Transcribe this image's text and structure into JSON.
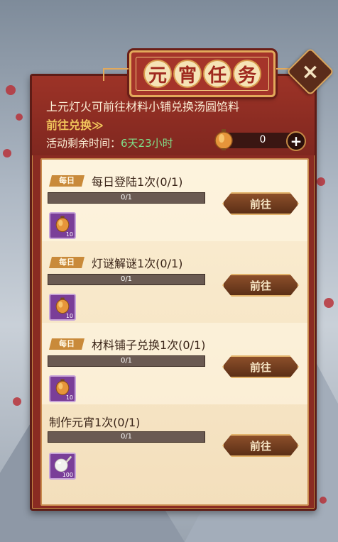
{
  "title": [
    "元",
    "宵",
    "任",
    "务"
  ],
  "description": "上元灯火可前往材料小铺兑换汤圆馅料",
  "goto_link": "前往兑换≫",
  "time_label": "活动剩余时间：",
  "time_value": "6天23小时",
  "currency": {
    "icon": "lantern-icon",
    "value": "0",
    "add_icon": "plus-icon"
  },
  "tasks": [
    {
      "tag": "每日",
      "title": "每日登陆1次(0/1)",
      "progress_text": "0/1",
      "progress": 0,
      "reward_icon": "lantern-icon",
      "reward_count": "10",
      "button": "前往"
    },
    {
      "tag": "每日",
      "title": "灯谜解谜1次(0/1)",
      "progress_text": "0/1",
      "progress": 0,
      "reward_icon": "lantern-icon",
      "reward_count": "10",
      "button": "前往"
    },
    {
      "tag": "每日",
      "title": "材料铺子兑换1次(0/1)",
      "progress_text": "0/1",
      "progress": 0,
      "reward_icon": "lantern-icon",
      "reward_count": "10",
      "button": "前往"
    },
    {
      "tag": "",
      "title": "制作元宵1次(0/1)",
      "progress_text": "0/1",
      "progress": 0,
      "reward_icon": "tangyuan-icon",
      "reward_count": "100",
      "button": "前往"
    }
  ],
  "colors": {
    "panel": "#8a2b22",
    "gold": "#e3a95b",
    "highlight": "#f1c55b",
    "time_green": "#7fe08a"
  }
}
